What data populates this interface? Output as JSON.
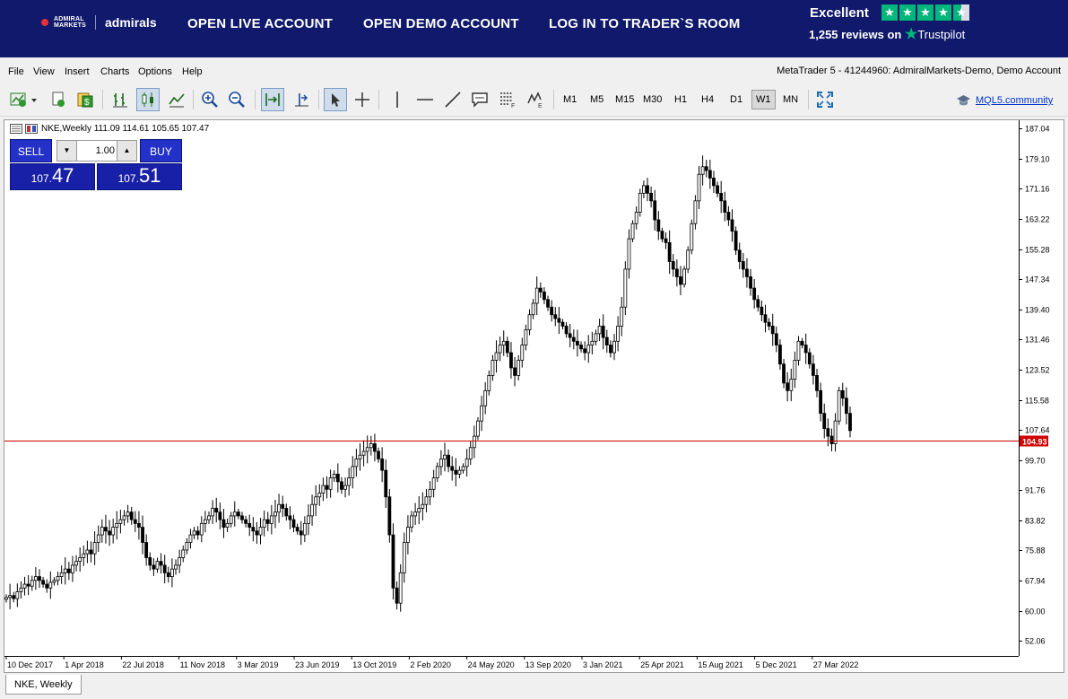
{
  "header": {
    "logo_brand_line1": "ADMIRAL",
    "logo_brand_line2": "MARKETS",
    "logo_name": "admirals",
    "nav": [
      {
        "label": "OPEN LIVE ACCOUNT"
      },
      {
        "label": "OPEN DEMO ACCOUNT"
      },
      {
        "label": "LOG IN TO TRADER`S ROOM"
      }
    ],
    "trustpilot": {
      "rating_text": "Excellent",
      "reviews": "1,255 reviews on",
      "brand": "Trustpilot",
      "stars": 4.5
    }
  },
  "menu": {
    "items": [
      "File",
      "View",
      "Insert",
      "Charts",
      "Options",
      "Help"
    ],
    "account_info": "MetaTrader 5 - 41244960: AdmiralMarkets-Demo, Demo Account"
  },
  "toolbar": {
    "timeframes": [
      "M1",
      "M5",
      "M15",
      "M30",
      "H1",
      "H4",
      "D1",
      "W1",
      "MN"
    ],
    "active_timeframe": "W1",
    "mql5_link": "MQL5.community"
  },
  "chart": {
    "symbol_info": "NKE,Weekly  111.09 114.61 105.65 107.47",
    "current_price_label": "104.93",
    "tab_label": "NKE, Weekly"
  },
  "trade_panel": {
    "sell_label": "SELL",
    "buy_label": "BUY",
    "volume": "1.00",
    "sell_price_small": "107.",
    "sell_price_big": "47",
    "buy_price_small": "107.",
    "buy_price_big": "51"
  },
  "chart_data": {
    "type": "candlestick",
    "y_ticks": [
      "187.04",
      "179.10",
      "171.16",
      "163.22",
      "155.28",
      "147.34",
      "139.40",
      "131.46",
      "123.52",
      "115.58",
      "107.64",
      "99.70",
      "91.76",
      "83.82",
      "75.88",
      "67.94",
      "60.00",
      "52.06"
    ],
    "x_ticks": [
      "10 Dec 2017",
      "1 Apr 2018",
      "22 Jul 2018",
      "11 Nov 2018",
      "3 Mar 2019",
      "23 Jun 2019",
      "13 Oct 2019",
      "2 Feb 2020",
      "24 May 2020",
      "13 Sep 2020",
      "3 Jan 2021",
      "25 Apr 2021",
      "15 Aug 2021",
      "5 Dec 2021",
      "27 Mar 2022"
    ],
    "ylim": [
      48.1,
      189.0
    ],
    "horizontal_line": 104.93,
    "close_series": [
      63.5,
      64,
      63.2,
      65,
      66,
      67,
      66.5,
      68,
      69,
      68,
      67,
      66,
      67.5,
      68,
      69,
      70,
      71,
      70,
      72,
      73,
      74,
      75,
      76,
      75,
      78,
      80,
      82,
      81,
      80,
      82,
      83,
      84,
      85,
      86,
      84,
      83,
      82,
      78,
      74,
      72,
      71,
      73,
      72,
      70,
      69,
      71,
      72,
      74,
      76,
      78,
      80,
      81,
      80,
      83,
      84,
      85,
      87,
      86,
      84,
      82,
      83,
      85,
      86,
      85,
      84,
      83,
      82,
      81,
      80,
      82,
      84,
      83,
      85,
      86,
      88,
      87,
      85,
      84,
      82,
      81,
      80,
      83,
      85,
      88,
      90,
      91,
      93,
      92,
      95,
      96,
      94,
      92,
      93,
      95,
      98,
      100,
      101,
      102,
      103,
      104,
      102,
      100,
      97,
      90,
      80,
      66,
      62,
      70,
      78,
      82,
      85,
      86,
      87,
      88,
      90,
      92,
      95,
      98,
      100,
      101,
      98,
      97,
      96,
      97,
      98,
      100,
      103,
      106,
      110,
      114,
      118,
      122,
      126,
      128,
      130,
      131,
      128,
      124,
      122,
      126,
      130,
      134,
      138,
      141,
      145,
      144,
      142,
      140,
      138,
      137,
      136,
      135,
      133,
      132,
      131,
      130,
      129,
      128,
      130,
      131,
      133,
      135,
      132,
      130,
      128,
      131,
      135,
      140,
      150,
      158,
      162,
      165,
      170,
      172,
      170,
      168,
      163,
      160,
      158,
      157,
      152,
      150,
      148,
      146,
      150,
      155,
      162,
      168,
      175,
      177,
      176,
      174,
      172,
      170,
      168,
      165,
      163,
      160,
      155,
      152,
      150,
      148,
      145,
      142,
      140,
      138,
      136,
      135,
      133,
      130,
      125,
      120,
      118,
      121,
      126,
      131,
      130,
      128,
      125,
      122,
      118,
      112,
      108,
      106,
      104,
      110,
      118,
      116,
      112,
      107.47
    ]
  }
}
